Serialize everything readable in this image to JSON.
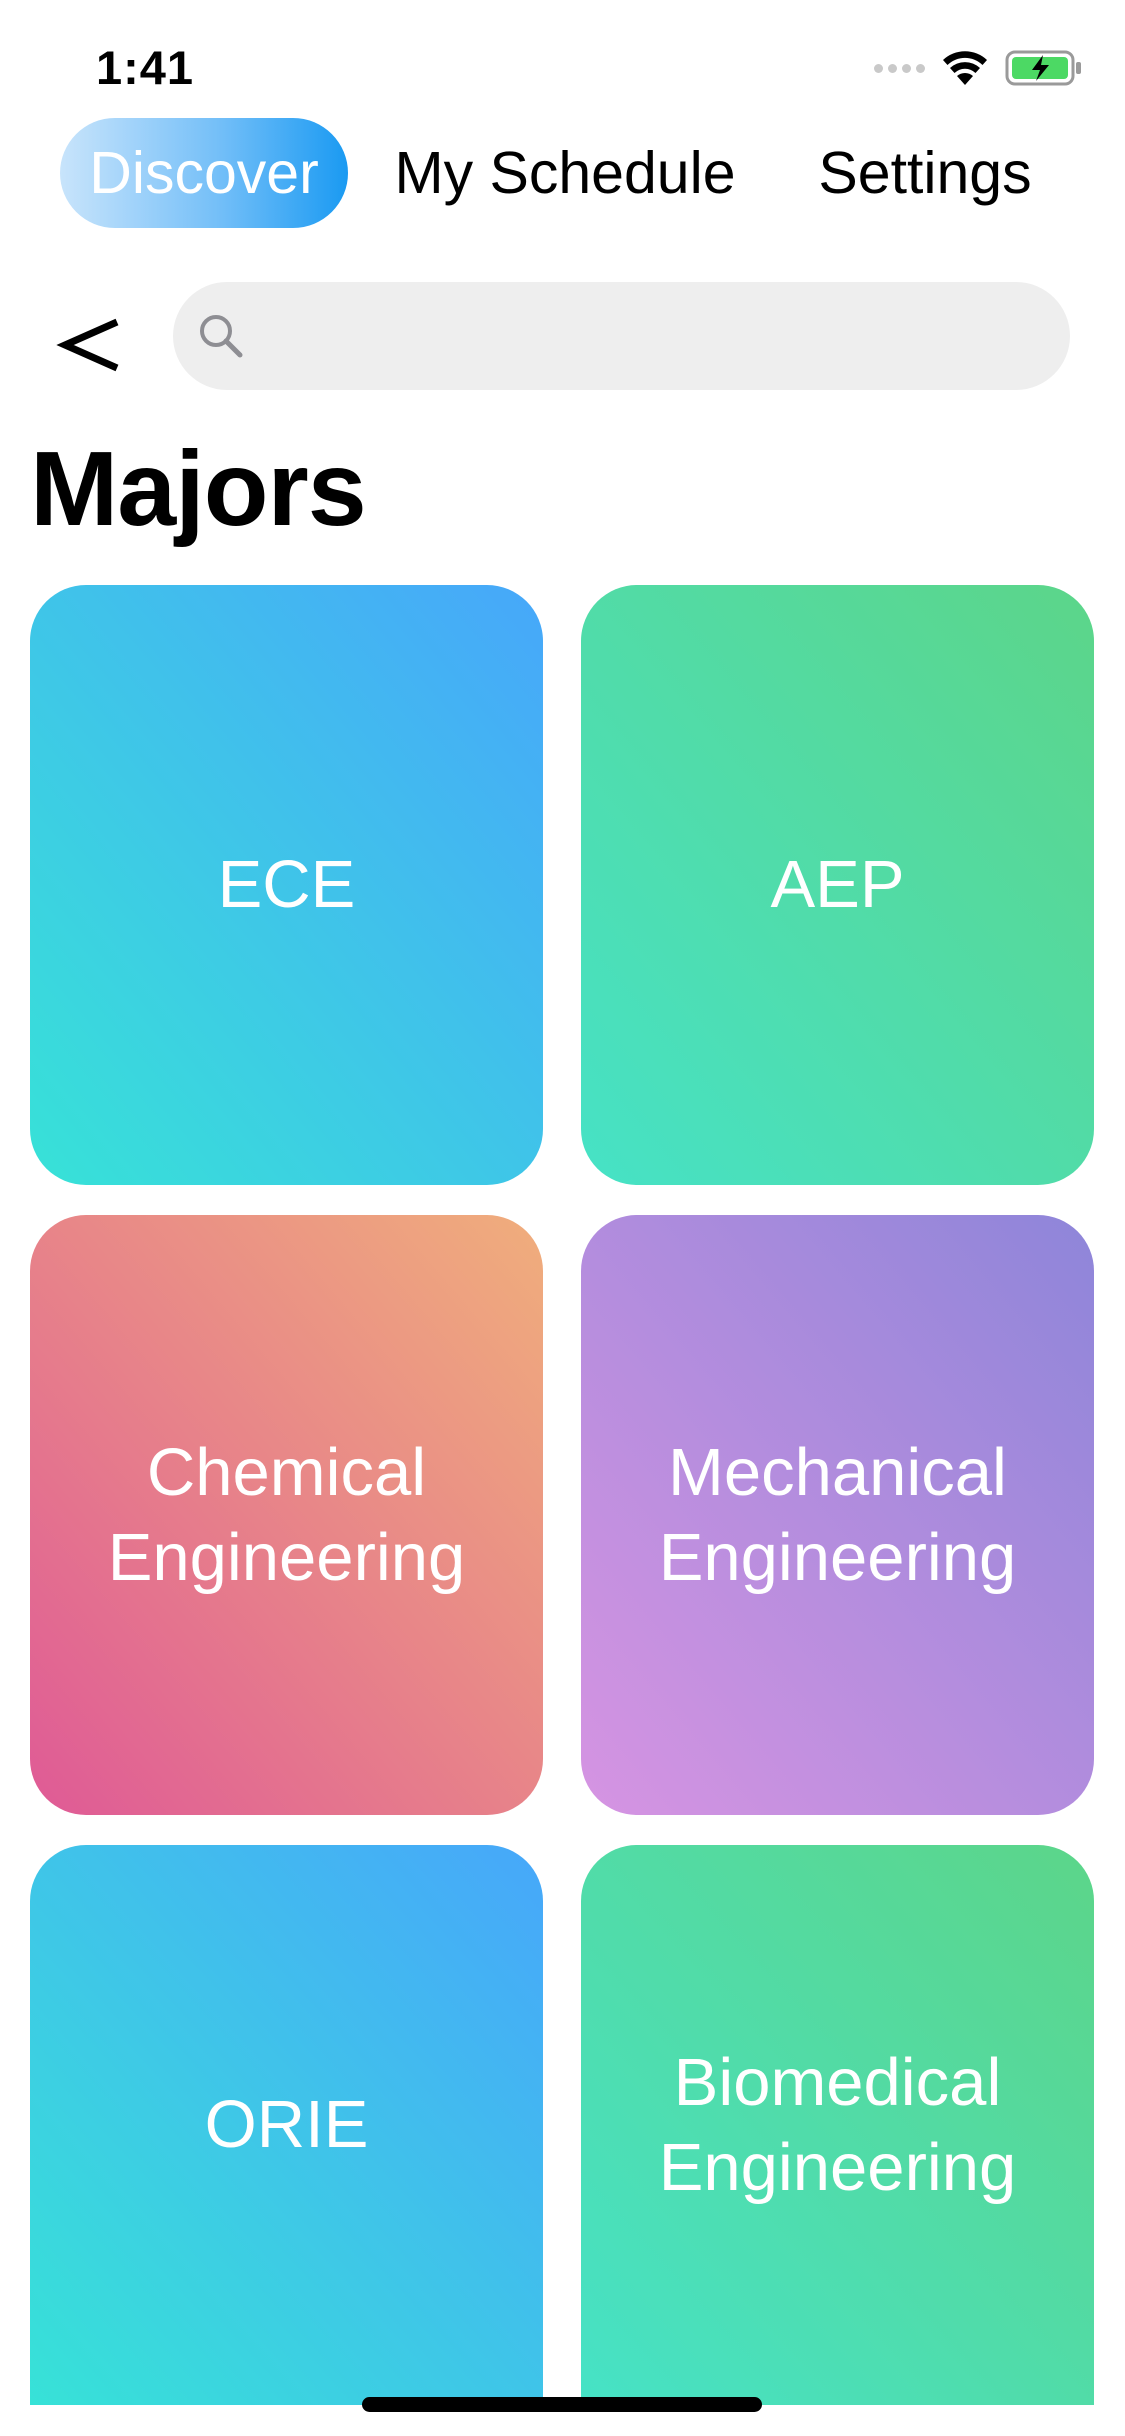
{
  "status_bar": {
    "time": "1:41",
    "icons": [
      "signal-icon",
      "wifi-icon",
      "battery-charging-icon"
    ]
  },
  "tabs": [
    {
      "label": "Discover",
      "active": true
    },
    {
      "label": "My Schedule",
      "active": false
    },
    {
      "label": "Settings",
      "active": false
    }
  ],
  "nav": {
    "back_icon": "chevron-left-icon"
  },
  "search": {
    "value": "",
    "placeholder": "",
    "icon": "search-icon"
  },
  "page_title": "Majors",
  "majors": [
    {
      "label": "ECE",
      "gradient": [
        "#37e2d7",
        "#47a7fa"
      ]
    },
    {
      "label": "AEP",
      "gradient": [
        "#46e2c6",
        "#5cd589"
      ]
    },
    {
      "label": "Chemical\nEngineering",
      "gradient": [
        "#df5a96",
        "#f0ae7c"
      ]
    },
    {
      "label": "Mechanical\nEngineering",
      "gradient": [
        "#d694e2",
        "#8e85d9"
      ]
    },
    {
      "label": "ORIE",
      "gradient": [
        "#37e2d7",
        "#47a7fa"
      ]
    },
    {
      "label": "Biomedical\nEngineering",
      "gradient": [
        "#46e2c6",
        "#5cd589"
      ]
    }
  ],
  "colors": {
    "accent": "#1a9af2",
    "search_bg": "#eeeeee",
    "text": "#000000",
    "battery": "#4cd964"
  }
}
